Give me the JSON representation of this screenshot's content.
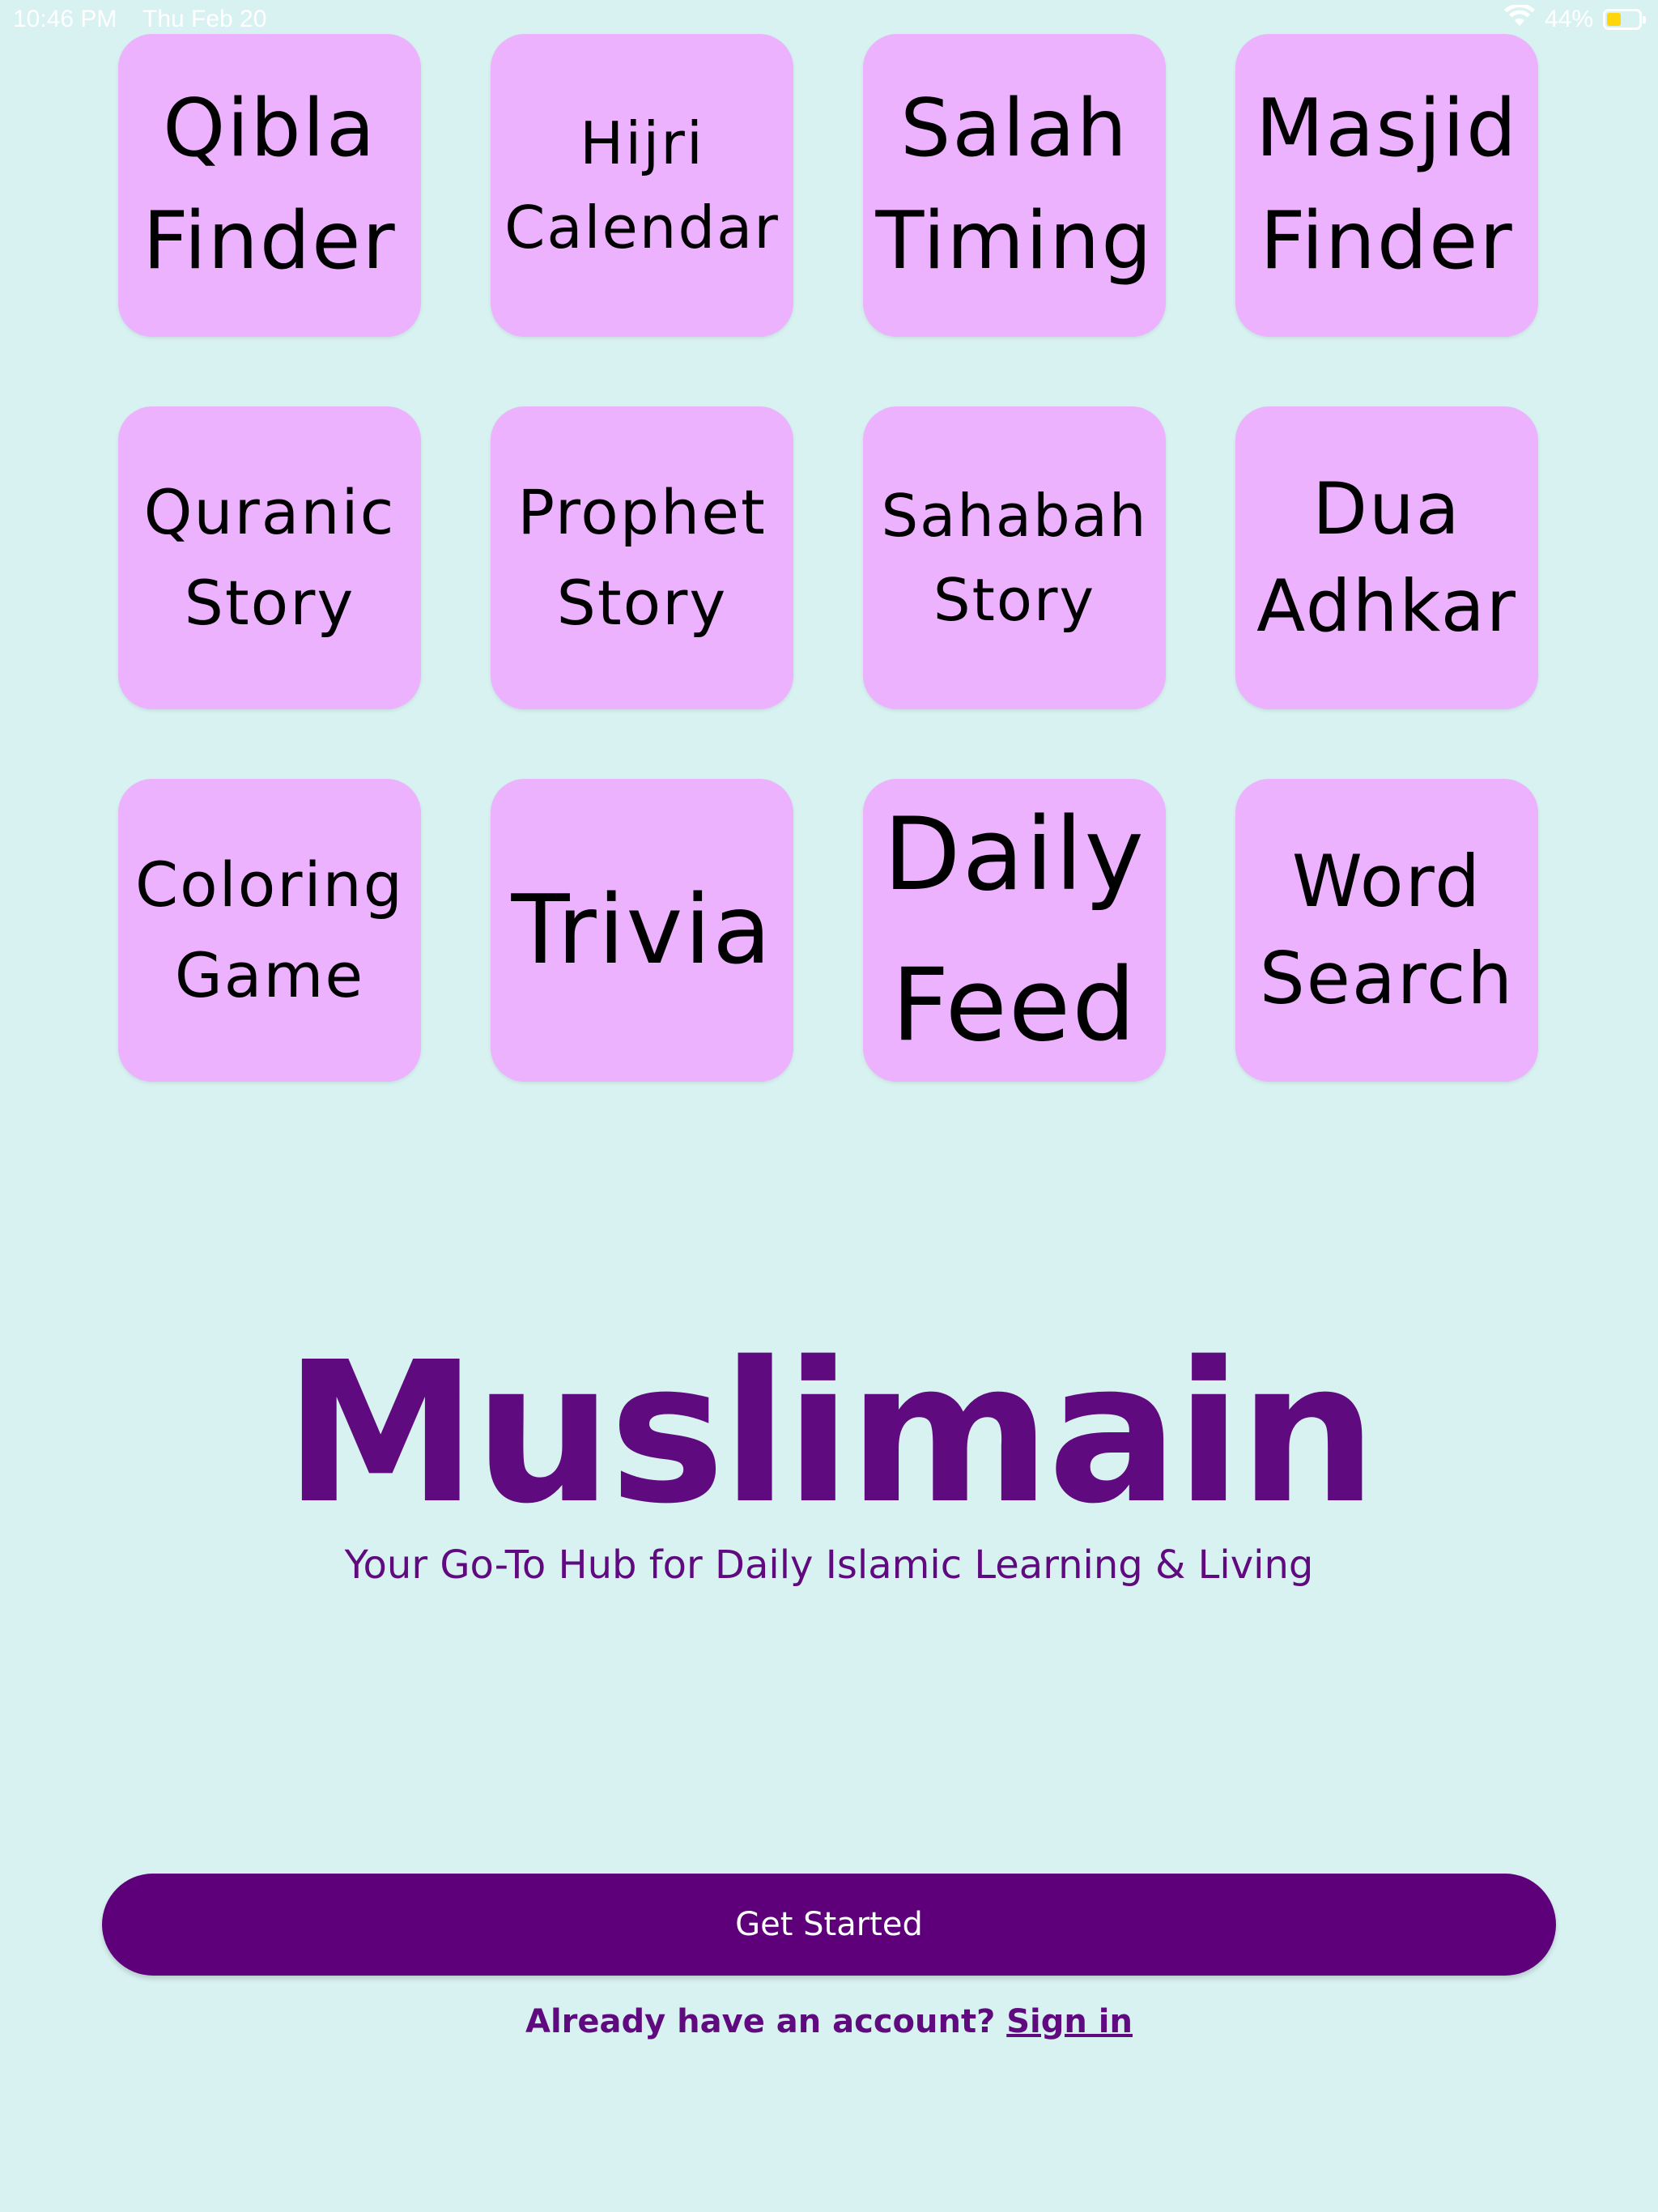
{
  "status_bar": {
    "time": "10:46 PM",
    "date": "Thu Feb 20",
    "battery_percent_label": "44%",
    "battery_level": 0.44,
    "battery_color": "#ffd60a",
    "wifi_icon": "wifi-icon"
  },
  "tiles": [
    {
      "label": "Qibla\nFinder"
    },
    {
      "label": "Hijri\nCalendar"
    },
    {
      "label": "Salah\nTiming"
    },
    {
      "label": "Masjid\nFinder"
    },
    {
      "label": "Quranic\nStory"
    },
    {
      "label": "Prophet\nStory"
    },
    {
      "label": "Sahabah\nStory"
    },
    {
      "label": "Dua\nAdhkar"
    },
    {
      "label": "Coloring\nGame"
    },
    {
      "label": "Trivia"
    },
    {
      "label": "Daily\nFeed"
    },
    {
      "label": "Word\nSearch"
    }
  ],
  "brand": {
    "title": "Muslimain",
    "tagline": "Your Go-To Hub for Daily Islamic Learning & Living"
  },
  "actions": {
    "get_started_label": "Get Started",
    "signin_prompt": "Already have an account?",
    "signin_link": "Sign in"
  },
  "colors": {
    "background": "#d8f1f1",
    "tile": "#ecb2fd",
    "primary": "#5d0079",
    "brand_text": "#5f0a7e"
  }
}
